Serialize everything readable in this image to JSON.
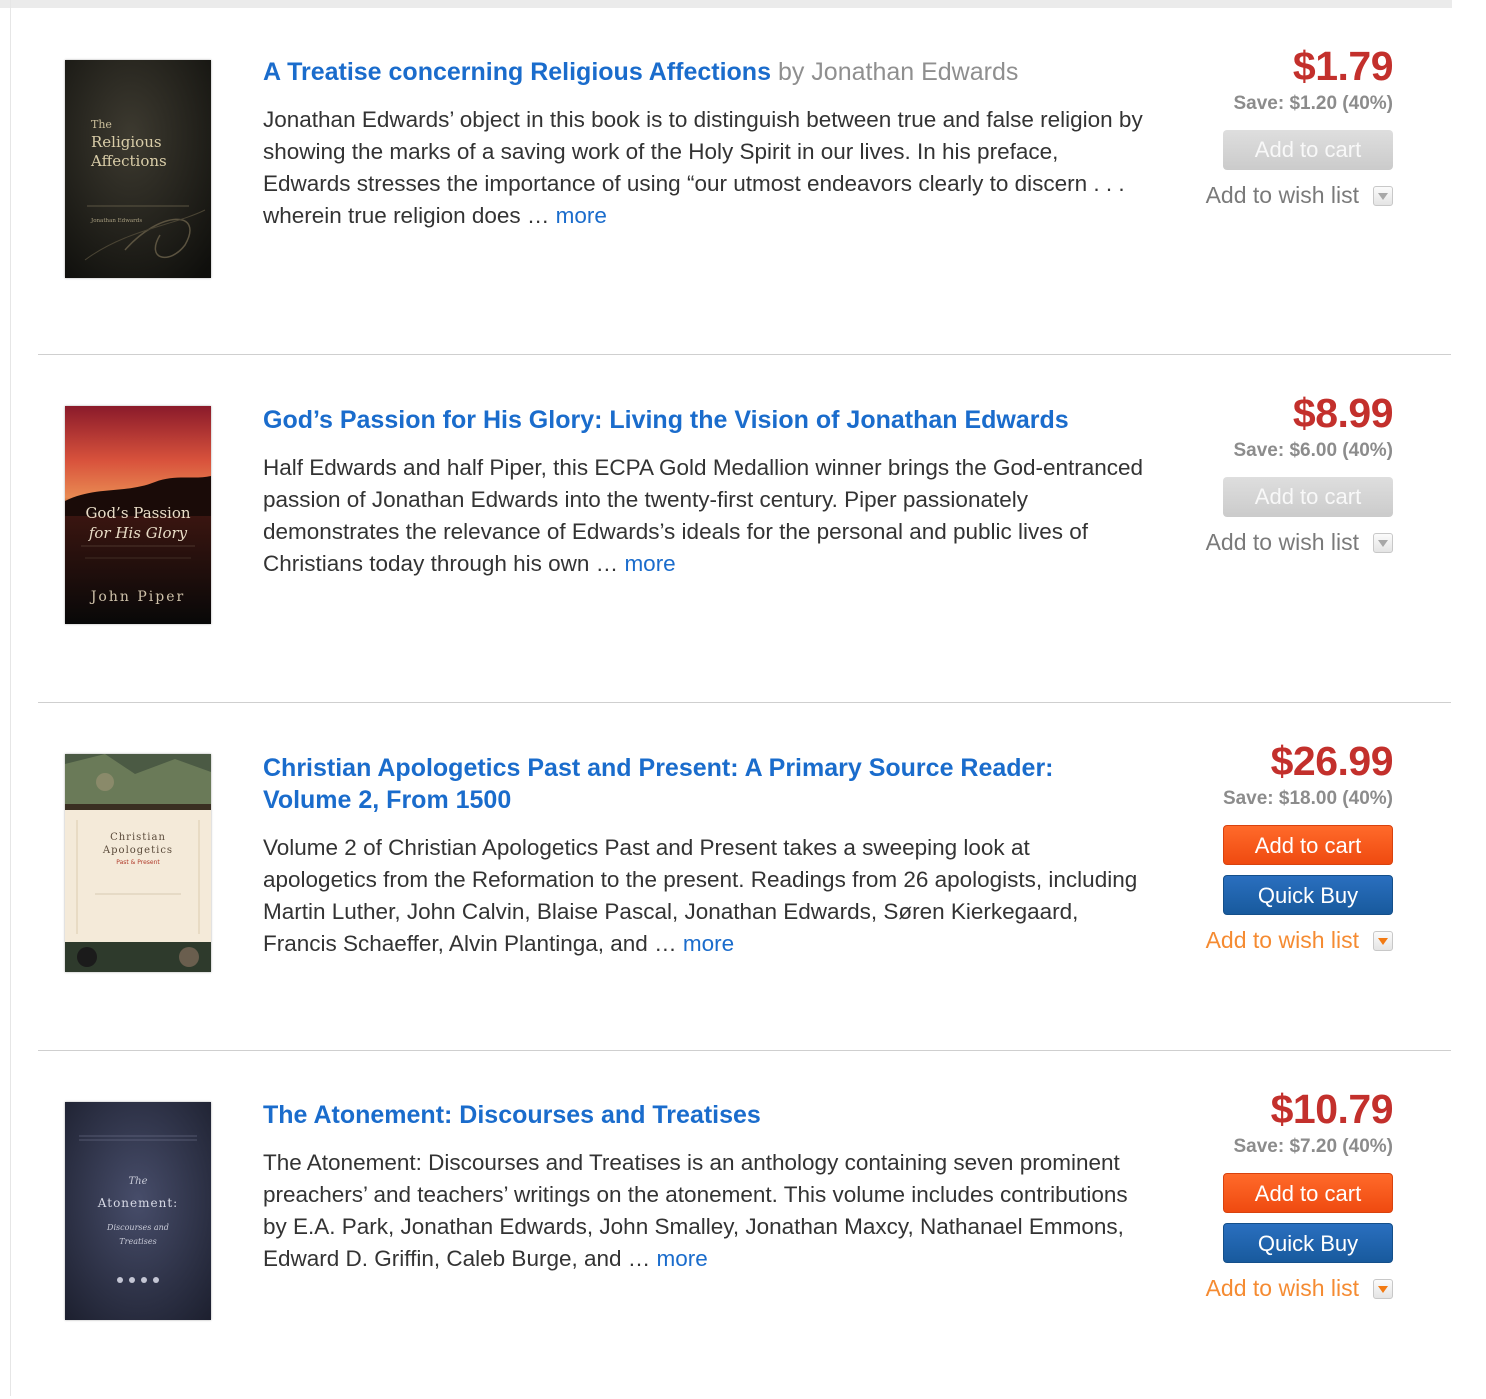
{
  "products": [
    {
      "title": "A Treatise concerning Religious Affections",
      "author": "by Jonathan Edwards",
      "description": "Jonathan Edwards’ object in this book is to distinguish between true and false religion by showing the marks of a saving work of the Holy Spirit in our lives. In his preface, Edwards stresses the importance of using “our utmost endeavors clearly to discern . . . wherein true religion does … ",
      "more": "more",
      "price": "$1.79",
      "save": "Save: $1.20 (40%)",
      "add_to_cart": "Add to cart",
      "add_to_wishlist": "Add to wish list",
      "cover": {
        "line1": "The",
        "line2": "Religious",
        "line3": "Affections",
        "author": "Jonathan Edwards"
      }
    },
    {
      "title": "God’s Passion for His Glory: Living the Vision of Jonathan Edwards",
      "author": "",
      "description": "Half Edwards and half Piper, this ECPA Gold Medallion winner brings the God-entranced passion of Jonathan Edwards into the twenty-first century. Piper passionately demonstrates the relevance of Edwards’s ideals for the personal and public lives of Christians today through his own … ",
      "more": "more",
      "price": "$8.99",
      "save": "Save: $6.00 (40%)",
      "add_to_cart": "Add to cart",
      "add_to_wishlist": "Add to wish list",
      "cover": {
        "line1": "God’s Passion",
        "line2": "for His Glory",
        "author": "John Piper"
      }
    },
    {
      "title": "Christian Apologetics Past and Present: A Primary Source Reader: Volume 2, From 1500",
      "author": "",
      "description": "Volume 2 of Christian Apologetics Past and Present takes a sweeping look at apologetics from the Reformation to the present. Readings from 26 apologists, including Martin Luther, John Calvin, Blaise Pascal, Jonathan Edwards, Søren Kierkegaard, Francis Schaeffer, Alvin Plantinga, and … ",
      "more": "more",
      "price": "$26.99",
      "save": "Save: $18.00 (40%)",
      "add_to_cart": "Add to cart",
      "quick_buy": "Quick Buy",
      "add_to_wishlist": "Add to wish list",
      "cover": {
        "line1": "Christian",
        "line2": "Apologetics",
        "line3": "Past & Present"
      }
    },
    {
      "title": "The Atonement: Discourses and Treatises",
      "author": "",
      "description": "The Atonement: Discourses and Treatises is an anthology containing seven prominent preachers’ and teachers’ writings on the atonement. This volume includes contributions by E.A. Park, Jonathan Edwards, John Smalley, Jonathan Maxcy, Nathanael Emmons, Edward D. Griffin, Caleb Burge, and … ",
      "more": "more",
      "price": "$10.79",
      "save": "Save: $7.20 (40%)",
      "add_to_cart": "Add to cart",
      "quick_buy": "Quick Buy",
      "add_to_wishlist": "Add to wish list",
      "cover": {
        "line1": "The",
        "line2": "Atonement:",
        "line3": "Discourses and",
        "line4": "Treatises"
      }
    }
  ],
  "colors": {
    "title_link": "#1a6ccc",
    "price": "#c3302c",
    "add_to_cart_active": "#f4551a",
    "add_to_cart_disabled": "#d4d4d4",
    "quick_buy": "#1f64ad",
    "wishlist_active": "#f58b32",
    "wishlist_inactive": "#7a7a7a"
  }
}
